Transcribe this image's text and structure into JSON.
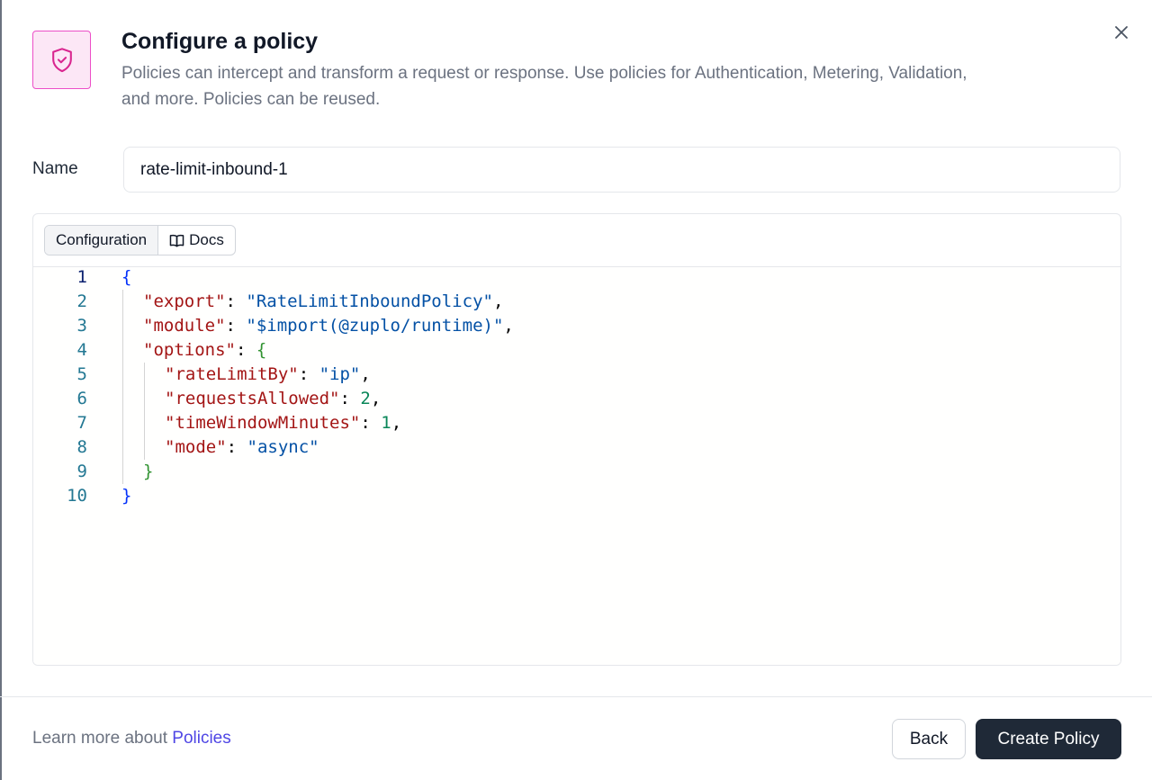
{
  "dialog": {
    "title": "Configure a policy",
    "subtitle": "Policies can intercept and transform a request or response. Use policies for Authentication, Metering, Validation, and more. Policies can be reused.",
    "icon": "shield-check-icon",
    "close_icon": "close-icon",
    "accent_color": "#ec4fc8"
  },
  "form": {
    "name_label": "Name",
    "name_value": "rate-limit-inbound-1"
  },
  "editor": {
    "tabs": [
      {
        "label": "Configuration",
        "active": true
      },
      {
        "label": "Docs",
        "icon": "book-open-icon",
        "active": false
      }
    ],
    "line_numbers": [
      "1",
      "2",
      "3",
      "4",
      "5",
      "6",
      "7",
      "8",
      "9",
      "10"
    ],
    "lines": [
      [
        {
          "t": "{",
          "c": "b1"
        }
      ],
      [
        {
          "t": "\"export\"",
          "c": "k"
        },
        {
          "t": ": ",
          "c": "p"
        },
        {
          "t": "\"RateLimitInboundPolicy\"",
          "c": "s"
        },
        {
          "t": ",",
          "c": "p"
        }
      ],
      [
        {
          "t": "\"module\"",
          "c": "k"
        },
        {
          "t": ": ",
          "c": "p"
        },
        {
          "t": "\"$import(@zuplo/runtime)\"",
          "c": "s"
        },
        {
          "t": ",",
          "c": "p"
        }
      ],
      [
        {
          "t": "\"options\"",
          "c": "k"
        },
        {
          "t": ": ",
          "c": "p"
        },
        {
          "t": "{",
          "c": "b2"
        }
      ],
      [
        {
          "t": "\"rateLimitBy\"",
          "c": "k"
        },
        {
          "t": ": ",
          "c": "p"
        },
        {
          "t": "\"ip\"",
          "c": "s"
        },
        {
          "t": ",",
          "c": "p"
        }
      ],
      [
        {
          "t": "\"requestsAllowed\"",
          "c": "k"
        },
        {
          "t": ": ",
          "c": "p"
        },
        {
          "t": "2",
          "c": "n"
        },
        {
          "t": ",",
          "c": "p"
        }
      ],
      [
        {
          "t": "\"timeWindowMinutes\"",
          "c": "k"
        },
        {
          "t": ": ",
          "c": "p"
        },
        {
          "t": "1",
          "c": "n"
        },
        {
          "t": ",",
          "c": "p"
        }
      ],
      [
        {
          "t": "\"mode\"",
          "c": "k"
        },
        {
          "t": ": ",
          "c": "p"
        },
        {
          "t": "\"async\"",
          "c": "s"
        }
      ],
      [
        {
          "t": "}",
          "c": "b2"
        }
      ],
      [
        {
          "t": "}",
          "c": "b1"
        }
      ]
    ]
  },
  "footer": {
    "learn_prefix": "Learn more about",
    "learn_link": "Policies",
    "back_label": "Back",
    "create_label": "Create Policy"
  }
}
